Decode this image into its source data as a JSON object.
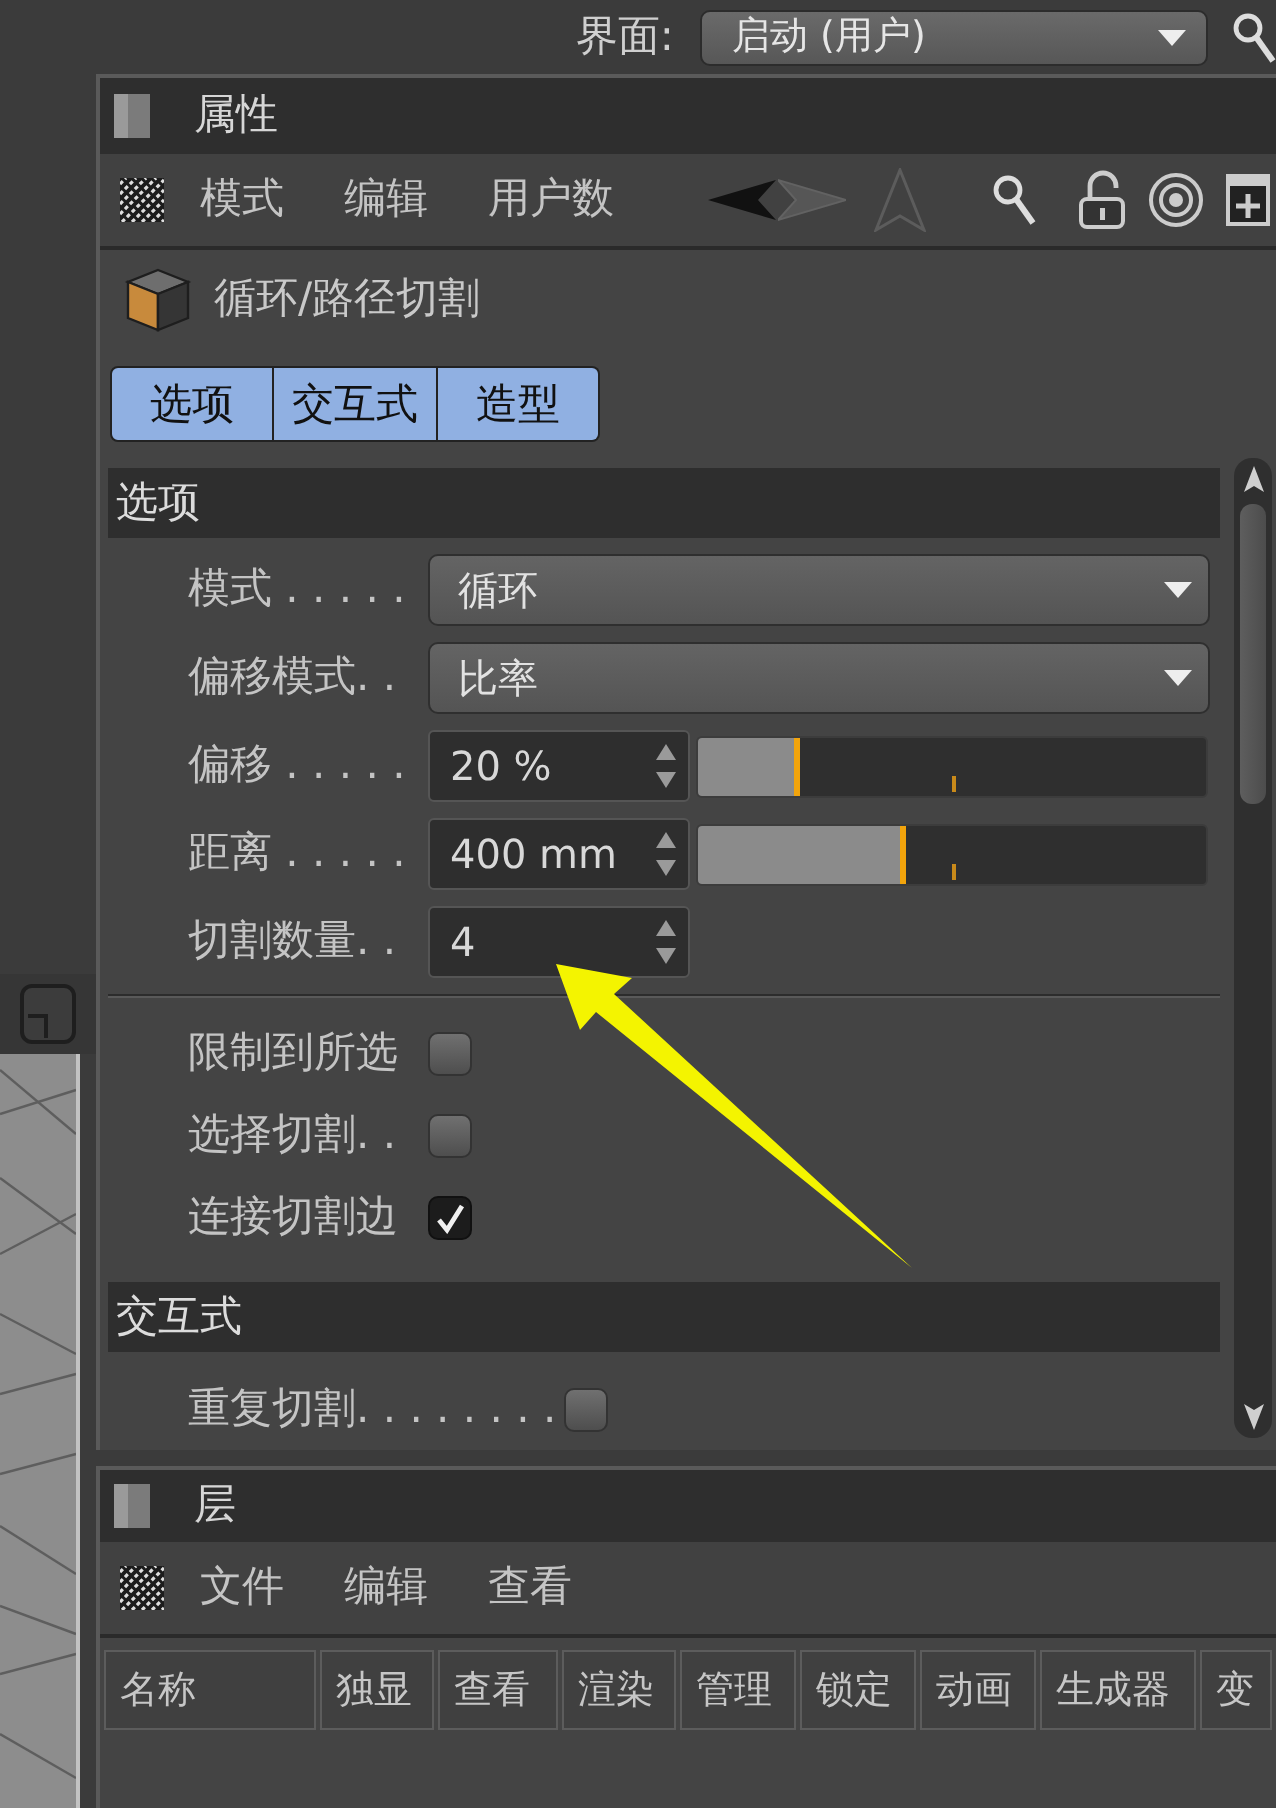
{
  "top_bar": {
    "label": "界面:",
    "layout_value": "启动 (用户)"
  },
  "attributes_panel": {
    "title": "属性",
    "menu": [
      "模式",
      "编辑",
      "用户数"
    ],
    "tool_title": "循环/路径切割",
    "tabs": [
      {
        "label": "选项",
        "selected": true
      },
      {
        "label": "交互式",
        "selected": true
      },
      {
        "label": "造型",
        "selected": true
      }
    ],
    "sections": [
      {
        "title": "选项",
        "fields": [
          {
            "kind": "dropdown",
            "label": "模式 . . . . .",
            "value": "循环"
          },
          {
            "kind": "dropdown",
            "label": "偏移模式. .",
            "value": "比率"
          },
          {
            "kind": "slider",
            "label": "偏移 . . . . .",
            "value": "20 %",
            "level": 0.2
          },
          {
            "kind": "slider",
            "label": "距离 . . . . .",
            "value": "400 mm",
            "level": 0.41
          },
          {
            "kind": "number",
            "label": "切割数量. .",
            "value": "4"
          },
          {
            "kind": "checkbox",
            "label": "限制到所选",
            "checked": false
          },
          {
            "kind": "checkbox",
            "label": "选择切割. .",
            "checked": false
          },
          {
            "kind": "checkbox",
            "label": "连接切割边",
            "checked": true
          }
        ]
      },
      {
        "title": "交互式",
        "fields": [
          {
            "kind": "checkbox",
            "label": "重复切割. . . . . . . .",
            "checked": false
          }
        ]
      }
    ]
  },
  "layers_panel": {
    "title": "层",
    "menu": [
      "文件",
      "编辑",
      "查看"
    ],
    "columns": [
      "名称",
      "独显",
      "查看",
      "渲染",
      "管理",
      "锁定",
      "动画",
      "生成器",
      "变"
    ]
  },
  "annotation": {
    "kind": "arrow"
  }
}
